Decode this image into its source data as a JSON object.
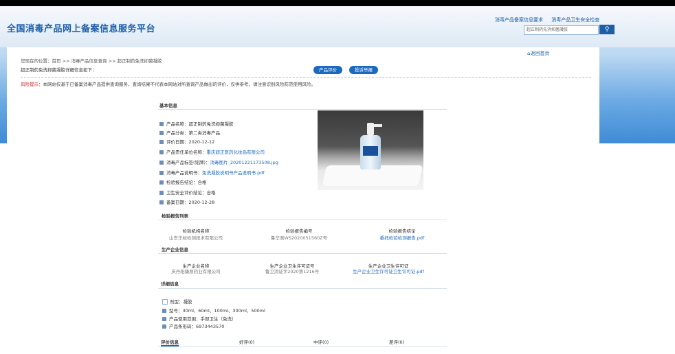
{
  "site": {
    "title": "全国消毒产品网上备案信息服务平台",
    "top_links": [
      "消毒产品备案信息要求",
      "消毒产品卫生安全检查"
    ],
    "search_value": "超正制药先消抑菌凝胶",
    "search_icon": "search-icon"
  },
  "page": {
    "return_link": "返回首页",
    "breadcrumb": "您现在的位置：首页 >> 消毒产品信息查询 >> 超正制药免洗抑菌凝胶",
    "lead": "超正制药免洗抑菌凝胶详细信息如下：",
    "buttons": {
      "review": "产品评价",
      "complaint": "投诉举报"
    },
    "tip_label": "风险提示：",
    "tip_text": "本网站仅基于已备案消毒产品提供查询服务，查询结果不代表本网站对所查询产品做出的评价，仅供参考，请注意识别风险防范使用风险。"
  },
  "basic": {
    "header": "基本信息",
    "rows": [
      {
        "label": "产品名称：",
        "value": "超正制药免洗抑菌凝胶",
        "link": false
      },
      {
        "label": "产品分类：",
        "value": "第二类消毒产品",
        "link": false
      },
      {
        "label": "评价日期：",
        "value": "2020-12-12",
        "link": false
      },
      {
        "label": "产品责任单位名称：",
        "value": "重庆超正医药化妆品有限公司",
        "link": true
      },
      {
        "label": "消毒产品标签(铭牌)：",
        "value": "消毒图片_20201221173508.jpg",
        "link": true
      },
      {
        "label": "消毒产品说明书：",
        "value": "免洗凝胶说明书产品说明书.pdf",
        "link": true
      },
      {
        "label": "检验报告结论：",
        "value": "合格",
        "link": false
      },
      {
        "label": "卫生安全评价结论：",
        "value": "合格",
        "link": false
      },
      {
        "label": "备案日期：",
        "value": "2020-12-28",
        "link": false
      }
    ]
  },
  "inspection": {
    "header": "检验报告列表",
    "columns": [
      "检验机构名称",
      "检验报告编号",
      "检验报告结论"
    ],
    "values": [
      "山东华标检测技术有限公司",
      "鲁华测WS2020051560Z号",
      "委托检验检测报告.pdf"
    ]
  },
  "producer": {
    "header": "生产企业信息",
    "columns": [
      "生产企业名称",
      "生产企业卫生许可证号",
      "生产企业卫生许可证"
    ],
    "values": [
      "庆丹阳康原药业有限公司",
      "鲁卫消证字2020第1216号",
      "生产企业卫生许可证卫生许可证.pdf"
    ]
  },
  "detail": {
    "header": "详细信息",
    "rows": [
      {
        "label": "剂型：",
        "value": "凝胶"
      },
      {
        "label": "型号：",
        "value": "30ml、60ml、100ml、300ml、500ml"
      },
      {
        "label": "产品使用范围：",
        "value": "手部卫生（免洗）"
      },
      {
        "label": "产品条形码：",
        "value": "6973443570"
      }
    ]
  },
  "reviews": {
    "tabs": [
      "评价信息",
      "好评(0)",
      "中评(0)",
      "差评(0)"
    ]
  }
}
